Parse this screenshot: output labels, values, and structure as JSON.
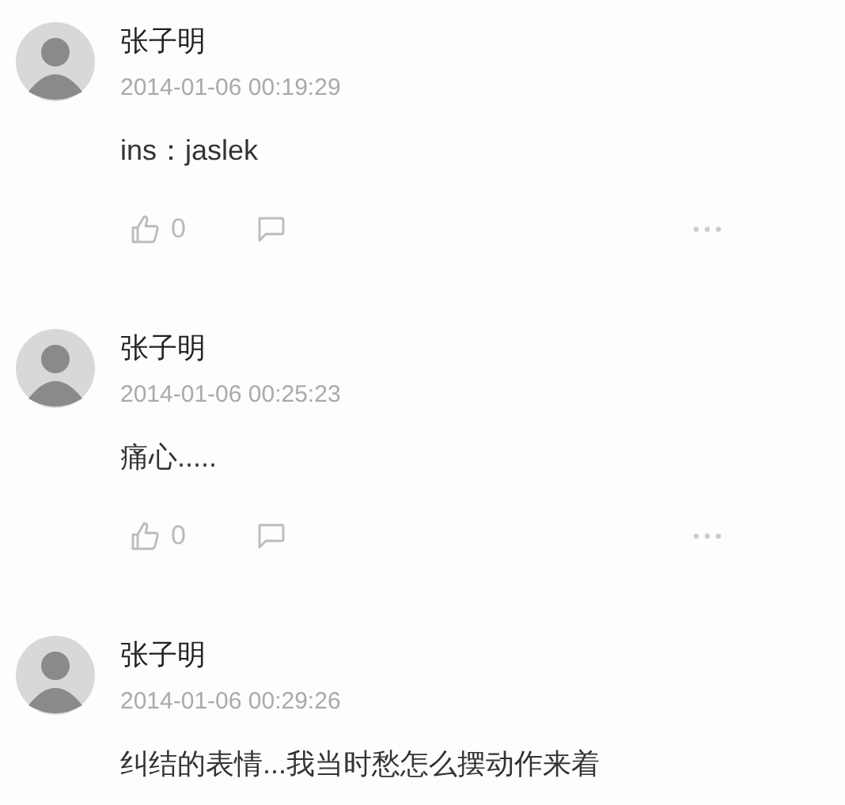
{
  "comments": [
    {
      "name": "张子明",
      "time": "2014-01-06 00:19:29",
      "text": "ins：jaslek",
      "actions": {
        "likes": "0"
      }
    },
    {
      "name": "张子明",
      "time": "2014-01-06 00:25:23",
      "text": "痛心.....",
      "actions": {
        "likes": "0"
      }
    },
    {
      "name": "张子明",
      "time": "2014-01-06 00:29:26",
      "text": "纠结的表情...我当时愁怎么摆动作来着"
    }
  ]
}
